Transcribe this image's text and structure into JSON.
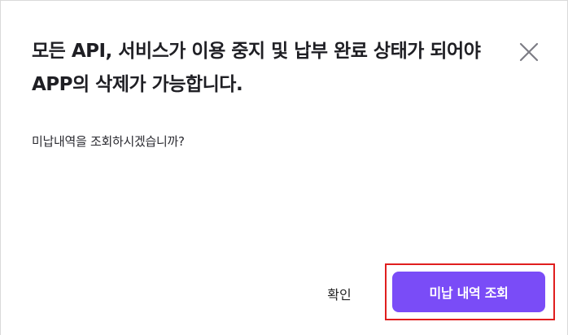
{
  "dialog": {
    "title": "모든 API, 서비스가 이용 중지 및 납부 완료 상태가 되어야 APP의 삭제가 가능합니다.",
    "message": "미납내역을 조회하시겠습니까?",
    "close_icon": "close-icon",
    "buttons": {
      "confirm_label": "확인",
      "view_unpaid_label": "미납 내역 조회"
    }
  },
  "colors": {
    "primary": "#7a4cf7",
    "highlight": "#e01e1e",
    "title_text": "#1f1f24"
  }
}
